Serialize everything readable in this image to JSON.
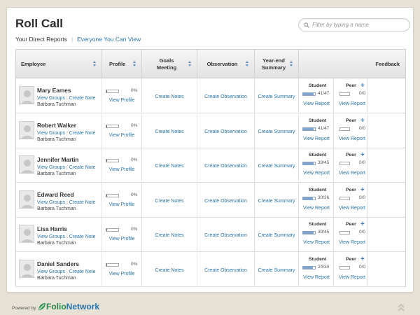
{
  "page": {
    "title": "Roll Call",
    "filter_placeholder": "Filter by typing a name",
    "subnav": {
      "active": "Your Direct Reports",
      "link": "Everyone You Can View"
    }
  },
  "table": {
    "headers": {
      "employee": "Employee",
      "profile": "Profile",
      "goals": "Goals Meeting",
      "observation": "Observation",
      "summary": "Year-end Summary",
      "feedback": "Feedback"
    },
    "feedback_labels": {
      "student": "Student",
      "peer": "Peer"
    },
    "link_labels": {
      "view_groups": "View Groups",
      "create_note": "Create Note",
      "view_profile": "View Profile",
      "create_notes": "Create Notes",
      "create_observation": "Create Observation",
      "create_summary": "Create Summary",
      "view_report": "View Report"
    },
    "rows": [
      {
        "name": "Mary Eames",
        "manager": "Barbara Tuchman",
        "profile_pct": "0%",
        "student": "41/47",
        "peer": "0/0"
      },
      {
        "name": "Robert Walker",
        "manager": "Barbara Tuchman",
        "profile_pct": "0%",
        "student": "41/47",
        "peer": "0/0"
      },
      {
        "name": "Jennifer Martin",
        "manager": "Barbara Tuchman",
        "profile_pct": "0%",
        "student": "39/45",
        "peer": "0/0"
      },
      {
        "name": "Edward Reed",
        "manager": "Barbara Tuchman",
        "profile_pct": "0%",
        "student": "30/36",
        "peer": "0/0"
      },
      {
        "name": "Lisa Harris",
        "manager": "Barbara Tuchman",
        "profile_pct": "0%",
        "student": "39/45",
        "peer": "0/0"
      },
      {
        "name": "Daniel Sanders",
        "manager": "Barbara Tuchman",
        "profile_pct": "0%",
        "student": "24/30",
        "peer": "0/0"
      }
    ]
  },
  "footer": {
    "powered_by": "Powered by",
    "brand_folio": "Folio",
    "brand_network": "Network"
  },
  "colors": {
    "link": "#2a73a8",
    "brand_green": "#2a8a4a",
    "progress_fill": "#7fa3cf",
    "background": "#e7e2d6"
  },
  "icons": {
    "search": "search-icon",
    "plus": "plus-icon",
    "sort": "sort-icon",
    "avatar": "avatar-placeholder",
    "scroll_top": "double-chevron-up-icon",
    "logo": "folio-leaf-icon"
  }
}
